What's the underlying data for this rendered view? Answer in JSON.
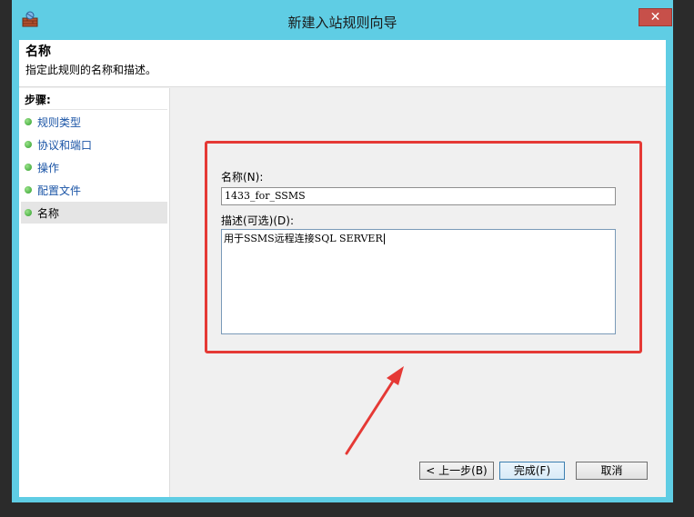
{
  "window": {
    "title": "新建入站规则向导",
    "close_glyph": "✕"
  },
  "header": {
    "title": "名称",
    "description": "指定此规则的名称和描述。"
  },
  "steps": {
    "title": "步骤:",
    "items": [
      {
        "label": "规则类型"
      },
      {
        "label": "协议和端口"
      },
      {
        "label": "操作"
      },
      {
        "label": "配置文件"
      },
      {
        "label": "名称"
      }
    ],
    "active_index": 4
  },
  "form": {
    "name_label": "名称(N):",
    "name_value": "1433_for_SSMS",
    "desc_label": "描述(可选)(D):",
    "desc_value": "用于SSMS远程连接SQL SERVER"
  },
  "buttons": {
    "back": "< 上一步(B)",
    "finish": "完成(F)",
    "cancel": "取消"
  },
  "colors": {
    "highlight": "#e53935",
    "title_bar": "#5fcde4",
    "close_button": "#c7504a"
  },
  "icons": [
    "firewall-wizard-icon",
    "close-icon",
    "step-bullet-icon",
    "annotation-arrow-icon"
  ]
}
